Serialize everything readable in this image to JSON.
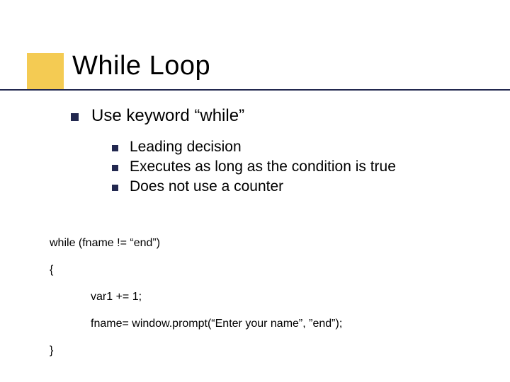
{
  "title": "While Loop",
  "lvl1_text": "Use keyword “while”",
  "lvl2": {
    "a": "Leading decision",
    "b": "Executes as long as the condition is true",
    "c": "Does not use a counter"
  },
  "code": {
    "line1": "while (fname != “end”)",
    "brace_open": "{",
    "line2": "var1 += 1;",
    "line3": "fname= window.prompt(“Enter your name”, ”end”);",
    "brace_close": "}"
  }
}
